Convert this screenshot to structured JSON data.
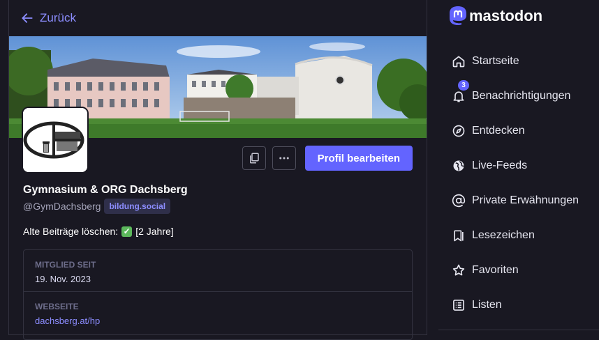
{
  "back": {
    "label": "Zurück"
  },
  "profile": {
    "name": "Gymnasium & ORG Dachsberg",
    "handle": "@GymDachsberg",
    "domain": "bildung.social",
    "bio_text": "Alte Beiträge löschen:",
    "bio_suffix": "[2 Jahre]",
    "edit_label": "Profil bearbeiten",
    "fields": [
      {
        "label": "MITGLIED SEIT",
        "value": "19. Nov. 2023"
      },
      {
        "label": "WEBSEITE",
        "value": "dachsberg.at/hp"
      }
    ]
  },
  "logo": {
    "text": "mastodon"
  },
  "nav": {
    "items": [
      {
        "label": "Startseite",
        "icon": "home-icon"
      },
      {
        "label": "Benachrichtigungen",
        "icon": "bell-icon",
        "badge": "3"
      },
      {
        "label": "Entdecken",
        "icon": "compass-icon"
      },
      {
        "label": "Live-Feeds",
        "icon": "globe-icon"
      },
      {
        "label": "Private Erwähnungen",
        "icon": "at-icon"
      },
      {
        "label": "Lesezeichen",
        "icon": "bookmark-icon"
      },
      {
        "label": "Favoriten",
        "icon": "star-icon"
      },
      {
        "label": "Listen",
        "icon": "list-icon"
      }
    ]
  },
  "colors": {
    "accent": "#6364ff",
    "link": "#8c8dff",
    "background": "#191822"
  }
}
